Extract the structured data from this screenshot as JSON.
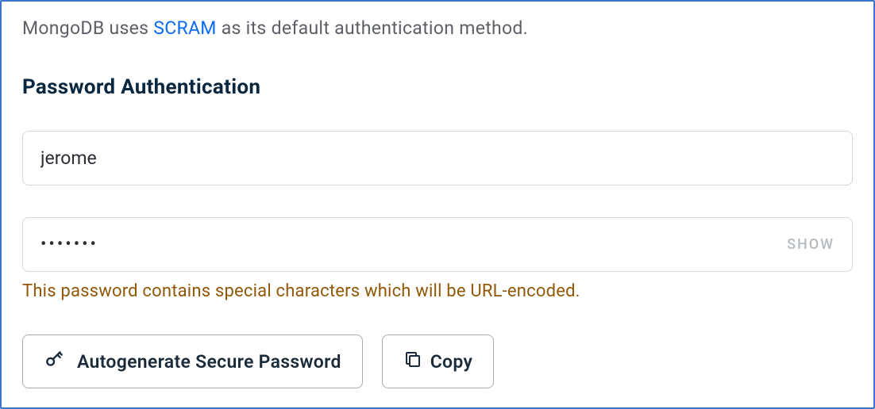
{
  "intro": {
    "prefix": "MongoDB uses ",
    "link_text": "SCRAM",
    "suffix": " as its default authentication method."
  },
  "heading": "Password Authentication",
  "username": {
    "value": "jerome"
  },
  "password": {
    "masked": "•••••••",
    "show_label": "SHOW"
  },
  "warning": "This password contains special characters which will be URL-encoded.",
  "buttons": {
    "autogen": "Autogenerate Secure Password",
    "copy": "Copy"
  },
  "icons": {
    "key": "key-icon",
    "copy": "copy-icon"
  }
}
